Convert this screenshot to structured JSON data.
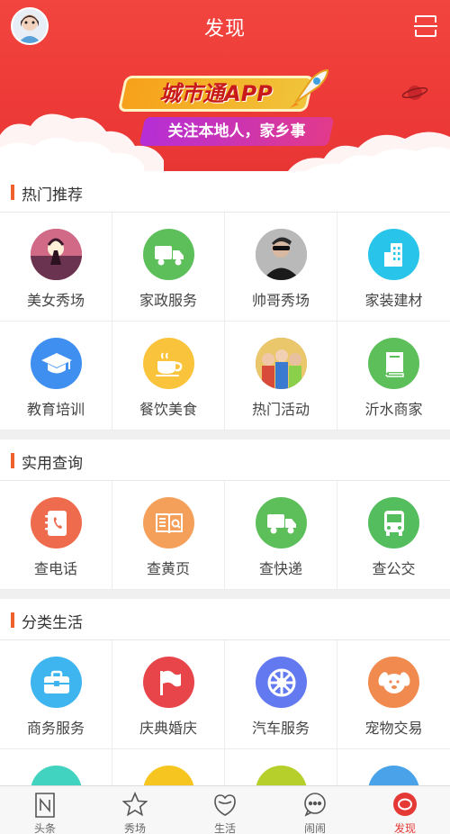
{
  "header": {
    "title": "发现",
    "banner_title": "城市通APP",
    "banner_subtitle": "关注本地人，家乡事"
  },
  "sections": [
    {
      "title": "热门推荐",
      "items": [
        {
          "label": "美女秀场",
          "icon": "photo-couple-icon",
          "color": "#c0485a"
        },
        {
          "label": "家政服务",
          "icon": "truck-icon",
          "color": "#5cbf5a"
        },
        {
          "label": "帅哥秀场",
          "icon": "photo-man-icon",
          "color": "#7a7a7a"
        },
        {
          "label": "家装建材",
          "icon": "building-icon",
          "color": "#29c4ea"
        },
        {
          "label": "教育培训",
          "icon": "graduation-cap-icon",
          "color": "#3f8ff0"
        },
        {
          "label": "餐饮美食",
          "icon": "coffee-cup-icon",
          "color": "#f9c43c"
        },
        {
          "label": "热门活动",
          "icon": "photo-group-icon",
          "color": "#d86b4a"
        },
        {
          "label": "沂水商家",
          "icon": "book-icon",
          "color": "#5cbf5a"
        }
      ]
    },
    {
      "title": "实用查询",
      "items": [
        {
          "label": "查电话",
          "icon": "phone-book-icon",
          "color": "#ef6b4e"
        },
        {
          "label": "查黄页",
          "icon": "yellow-pages-icon",
          "color": "#f5a05a"
        },
        {
          "label": "查快递",
          "icon": "truck-icon",
          "color": "#5cbf5a"
        },
        {
          "label": "查公交",
          "icon": "bus-icon",
          "color": "#54bd5e"
        }
      ]
    },
    {
      "title": "分类生活",
      "items": [
        {
          "label": "商务服务",
          "icon": "briefcase-icon",
          "color": "#3fb5f0"
        },
        {
          "label": "庆典婚庆",
          "icon": "flag-icon",
          "color": "#e8454b"
        },
        {
          "label": "汽车服务",
          "icon": "wheel-icon",
          "color": "#6279ef"
        },
        {
          "label": "宠物交易",
          "icon": "dog-icon",
          "color": "#f08a4e"
        },
        {
          "label": "",
          "icon": "partial-icon-teal",
          "color": "#42d2c0"
        },
        {
          "label": "",
          "icon": "partial-icon-yellow",
          "color": "#f7c51f"
        },
        {
          "label": "",
          "icon": "partial-icon-green",
          "color": "#b6cf2a"
        },
        {
          "label": "",
          "icon": "partial-icon-blue",
          "color": "#4aa3e8"
        }
      ]
    }
  ],
  "tabs": [
    {
      "label": "头条",
      "icon": "news-icon",
      "active": false
    },
    {
      "label": "秀场",
      "icon": "star-icon",
      "active": false
    },
    {
      "label": "生活",
      "icon": "life-icon",
      "active": false
    },
    {
      "label": "闹闹",
      "icon": "chat-icon",
      "active": false
    },
    {
      "label": "发现",
      "icon": "discover-icon",
      "active": true
    }
  ],
  "colors": {
    "brand_red": "#ee3b38",
    "section_bar": "#f0602d",
    "tab_active": "#e53935"
  }
}
